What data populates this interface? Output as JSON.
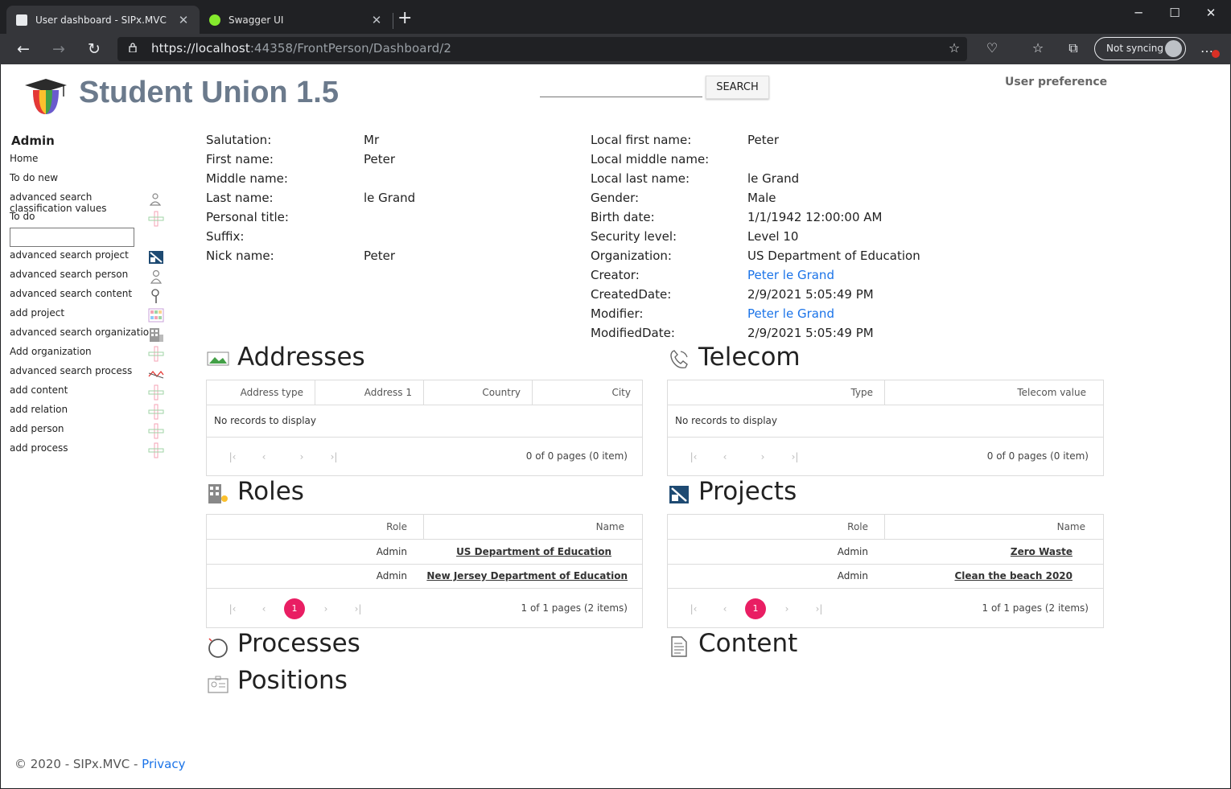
{
  "browser": {
    "tabs": [
      {
        "title": "User dashboard - SIPx.MVC"
      },
      {
        "title": "Swagger UI"
      }
    ],
    "url_main": "https://localhost",
    "url_rest": ":44358/FrontPerson/Dashboard/2",
    "sync_label": "Not syncing"
  },
  "header": {
    "brand": "Student Union 1.5",
    "search_button": "SEARCH",
    "user_preference": "User preference"
  },
  "sidebar": {
    "title": "Admin",
    "items": [
      {
        "label": "Home",
        "icon": ""
      },
      {
        "label": "To do new",
        "icon": ""
      },
      {
        "label": "advanced search classification values",
        "icon": "person-search-icon"
      },
      {
        "label": "To do",
        "icon": "plus-icon"
      },
      {
        "label": "advanced search project",
        "icon": "project-icon"
      },
      {
        "label": "advanced search person",
        "icon": "person-icon"
      },
      {
        "label": "advanced search content",
        "icon": "magnifier-icon"
      },
      {
        "label": "add project",
        "icon": "grid-color-icon"
      },
      {
        "label": "advanced search organization",
        "icon": "building-icon"
      },
      {
        "label": "Add organization",
        "icon": "plus-icon"
      },
      {
        "label": "advanced search process",
        "icon": "process-icon"
      },
      {
        "label": "add content",
        "icon": "plus-icon"
      },
      {
        "label": "add relation",
        "icon": "plus-icon"
      },
      {
        "label": "add person",
        "icon": "plus-icon"
      },
      {
        "label": "add process",
        "icon": "plus-icon"
      }
    ]
  },
  "details_left": [
    {
      "label": "Salutation:",
      "value": "Mr"
    },
    {
      "label": "First name:",
      "value": "Peter"
    },
    {
      "label": "Middle name:",
      "value": ""
    },
    {
      "label": "Last name:",
      "value": "le Grand"
    },
    {
      "label": "Personal title:",
      "value": ""
    },
    {
      "label": "Suffix:",
      "value": ""
    },
    {
      "label": "Nick name:",
      "value": "Peter"
    }
  ],
  "details_right": [
    {
      "label": "Local first name:",
      "value": "Peter"
    },
    {
      "label": "Local middle name:",
      "value": ""
    },
    {
      "label": "Local last name:",
      "value": "le Grand"
    },
    {
      "label": "Gender:",
      "value": "Male"
    },
    {
      "label": "Birth date:",
      "value": "1/1/1942 12:00:00 AM"
    },
    {
      "label": "Security level:",
      "value": "Level 10"
    },
    {
      "label": "Organization:",
      "value": "US Department of Education"
    },
    {
      "label": "Creator:",
      "value": "Peter le Grand"
    },
    {
      "label": "CreatedDate:",
      "value": "2/9/2021 5:05:49 PM"
    },
    {
      "label": "Modifier:",
      "value": "Peter le Grand"
    },
    {
      "label": "ModifiedDate:",
      "value": "2/9/2021 5:05:49 PM"
    }
  ],
  "sections": {
    "addresses": {
      "title": "Addresses",
      "columns": [
        "Address type",
        "Address 1",
        "Country",
        "City"
      ],
      "empty": "No records to display",
      "pager_info": "0 of 0 pages (0 item)"
    },
    "telecom": {
      "title": "Telecom",
      "columns": [
        "Type",
        "Telecom value"
      ],
      "empty": "No records to display",
      "pager_info": "0 of 0 pages (0 item)"
    },
    "roles": {
      "title": "Roles",
      "columns": [
        "Role",
        "Name"
      ],
      "rows": [
        {
          "role": "Admin",
          "name": "US Department of Education"
        },
        {
          "role": "Admin",
          "name": "New Jersey Department of Education"
        }
      ],
      "page": "1",
      "pager_info": "1 of 1 pages (2 items)"
    },
    "projects": {
      "title": "Projects",
      "columns": [
        "Role",
        "Name"
      ],
      "rows": [
        {
          "role": "Admin",
          "name": "Zero Waste"
        },
        {
          "role": "Admin",
          "name": "Clean the beach 2020"
        }
      ],
      "page": "1",
      "pager_info": "1 of 1 pages (2 items)"
    },
    "processes": {
      "title": "Processes"
    },
    "content": {
      "title": "Content"
    },
    "positions": {
      "title": "Positions"
    }
  },
  "footer": {
    "text": "© 2020 - SIPx.MVC - ",
    "privacy": "Privacy"
  }
}
